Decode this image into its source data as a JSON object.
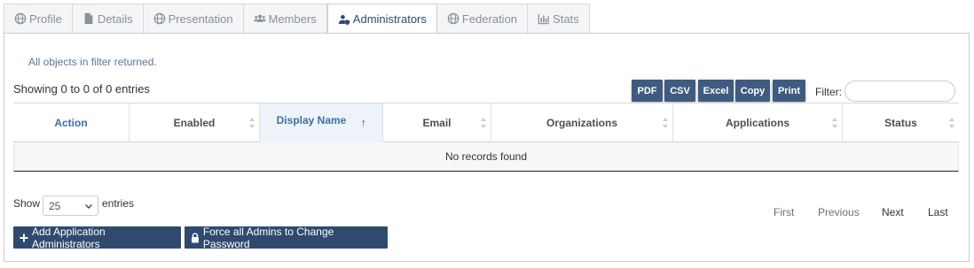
{
  "tabs": [
    {
      "label": "Profile",
      "icon": "globe-icon"
    },
    {
      "label": "Details",
      "icon": "document-icon"
    },
    {
      "label": "Presentation",
      "icon": "globe-icon"
    },
    {
      "label": "Members",
      "icon": "users-icon"
    },
    {
      "label": "Administrators",
      "icon": "user-shield-icon",
      "active": true
    },
    {
      "label": "Federation",
      "icon": "globe-icon"
    },
    {
      "label": "Stats",
      "icon": "bar-chart-icon"
    }
  ],
  "message": "All objects in filter returned.",
  "table_info": "Showing 0 to 0 of 0 entries",
  "export_buttons": {
    "pdf": "PDF",
    "csv": "CSV",
    "excel": "Excel",
    "copy": "Copy",
    "print": "Print"
  },
  "filter": {
    "label": "Filter:",
    "value": ""
  },
  "columns": {
    "action": "Action",
    "enabled": "Enabled",
    "display_name": "Display Name",
    "email": "Email",
    "organizations": "Organizations",
    "applications": "Applications",
    "status": "Status"
  },
  "empty_text": "No records found",
  "length": {
    "show": "Show",
    "value": "25",
    "entries": "entries"
  },
  "pagination": {
    "first": "First",
    "previous": "Previous",
    "next": "Next",
    "last": "Last"
  },
  "actions": {
    "add_admins": "Add Application Administrators",
    "force_password": "Force all Admins to Change Password"
  },
  "colors": {
    "primary": "#2f4a6e",
    "accent": "#3d6ea8",
    "message": "#5b7796"
  }
}
